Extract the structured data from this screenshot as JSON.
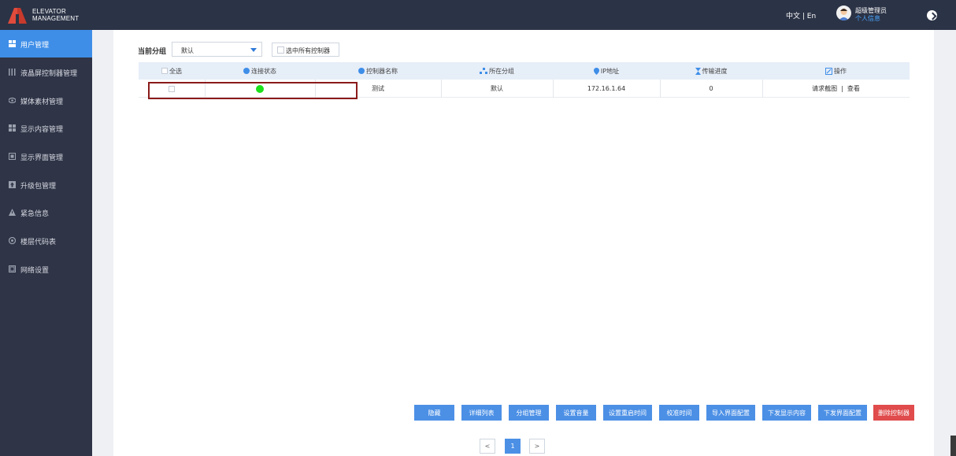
{
  "brand": {
    "line1": "ELEVATOR",
    "line2": "MANAGEMENT",
    "logo_icon": "elevator-logo-icon",
    "logo_color": "#e04b3b"
  },
  "header": {
    "language": "中文 | En",
    "user_name": "超级管理员",
    "user_link": "个人信息",
    "avatar_icon": "user-avatar-icon",
    "logout_icon": "logout-icon"
  },
  "sidebar": {
    "items": [
      {
        "label": "用户管理",
        "icon": "user-icon",
        "active": true
      },
      {
        "label": "液晶屏控制器管理",
        "icon": "controller-icon",
        "active": false
      },
      {
        "label": "媒体素材管理",
        "icon": "media-icon",
        "active": false
      },
      {
        "label": "显示内容管理",
        "icon": "grid-icon",
        "active": false
      },
      {
        "label": "显示界面管理",
        "icon": "display-icon",
        "active": false
      },
      {
        "label": "升级包管理",
        "icon": "upgrade-icon",
        "active": false
      },
      {
        "label": "紧急信息",
        "icon": "warning-icon",
        "active": false
      },
      {
        "label": "楼层代码表",
        "icon": "floor-icon",
        "active": false
      },
      {
        "label": "网络设置",
        "icon": "network-icon",
        "active": false
      }
    ]
  },
  "filter": {
    "group_label": "当前分组",
    "group_value": "默认",
    "select_all_controllers": "选中所有控制器"
  },
  "table": {
    "headers": {
      "select_all": "全选",
      "status": "连接状态",
      "name": "控制器名称",
      "group": "所在分组",
      "ip": "IP地址",
      "progress": "传输进度",
      "ops": "操作"
    },
    "rows": [
      {
        "status": "online",
        "status_color": "#1be11b",
        "name": "测试",
        "group": "默认",
        "ip": "172.16.1.64",
        "progress": "0",
        "op_screenshot": "请求截图",
        "op_divider": "|",
        "op_view": "查看"
      }
    ]
  },
  "actions": {
    "hide": "隐藏",
    "detail_list": "详细列表",
    "group_manage": "分组管理",
    "set_volume": "设置音量",
    "set_restart_time": "设置重启时间",
    "calibrate_time": "校准时间",
    "import_ui_config": "导入界面配置",
    "push_display_content": "下发显示内容",
    "push_ui_config": "下发界面配置",
    "delete_controller": "删除控制器"
  },
  "pagination": {
    "prev": "<",
    "current": "1",
    "next": ">"
  },
  "colors": {
    "primary": "#4c90e6",
    "danger": "#e04b4b",
    "sidebar": "#2f3447",
    "header": "#2b3346"
  }
}
